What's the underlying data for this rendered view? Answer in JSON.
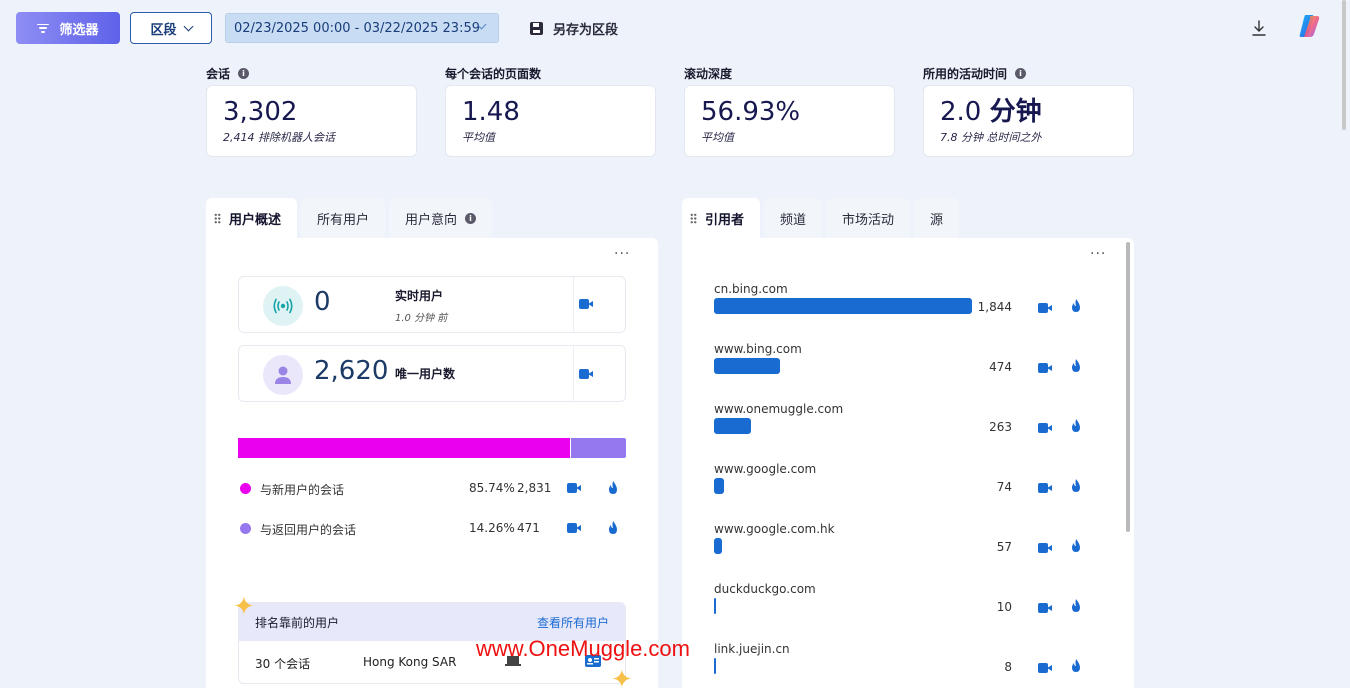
{
  "toolbar": {
    "filter_label": "筛选器",
    "segment_label": "区段",
    "date_range": "02/23/2025 00:00 - 03/22/2025 23:59",
    "save_segment_label": "另存为区段"
  },
  "kpis": [
    {
      "label": "会话",
      "value": "3,302",
      "sub": "2,414 排除机器人会话",
      "has_info": true
    },
    {
      "label": "每个会话的页面数",
      "value": "1.48",
      "sub": "平均值",
      "has_info": false
    },
    {
      "label": "滚动深度",
      "value": "56.93%",
      "sub": "平均值",
      "has_info": false
    },
    {
      "label": "所用的活动时间",
      "value_num": "2.0",
      "value_unit": "分钟",
      "sub": "7.8 分钟 总时间之外",
      "has_info": true
    }
  ],
  "left_tabs": [
    "用户概述",
    "所有用户",
    "用户意向"
  ],
  "right_tabs": [
    "引用者",
    "频道",
    "市场活动",
    "源"
  ],
  "users": {
    "live": {
      "value": "0",
      "title": "实时用户",
      "sub": "1.0 分钟 前"
    },
    "unique": {
      "value": "2,620",
      "title": "唯一用户数"
    },
    "split": [
      {
        "label": "与新用户的会话",
        "pct": "85.74%",
        "count": "2,831",
        "fraction": 0.8574,
        "color": "#ea00ee"
      },
      {
        "label": "与返回用户的会话",
        "pct": "14.26%",
        "count": "471",
        "fraction": 0.1426,
        "color": "#9577ef"
      }
    ],
    "top_users": {
      "title": "排名靠前的用户",
      "link": "查看所有用户",
      "row": {
        "sessions": "30 个会话",
        "region": "Hong Kong SAR"
      }
    }
  },
  "referrers": [
    {
      "name": "cn.bing.com",
      "count": "1,844",
      "value": 1844
    },
    {
      "name": "www.bing.com",
      "count": "474",
      "value": 474
    },
    {
      "name": "www.onemuggle.com",
      "count": "263",
      "value": 263
    },
    {
      "name": "www.google.com",
      "count": "74",
      "value": 74
    },
    {
      "name": "www.google.com.hk",
      "count": "57",
      "value": 57
    },
    {
      "name": "duckduckgo.com",
      "count": "10",
      "value": 10
    },
    {
      "name": "link.juejin.cn",
      "count": "8",
      "value": 8
    }
  ],
  "watermark": "www.OneMuggle.com",
  "colors": {
    "accent": "#1a6bd1",
    "new_users": "#ea00ee",
    "returning_users": "#9577ef"
  }
}
